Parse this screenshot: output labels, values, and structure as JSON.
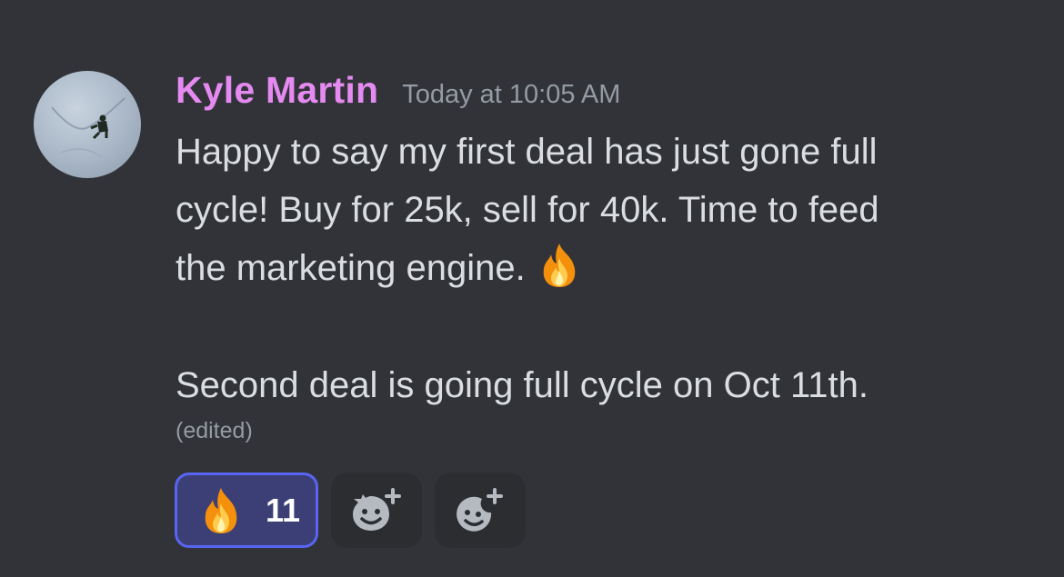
{
  "message": {
    "author": "Kyle Martin",
    "timestamp": "Today at 10:05 AM",
    "lines": [
      "Happy to say my first deal has just gone full",
      "cycle! Buy for 25k, sell for 40k. Time to feed",
      "the marketing engine.",
      "Second deal is going full cycle on Oct 11th."
    ],
    "edited_label": "(edited)",
    "inline_emoji": "fire-icon"
  },
  "reactions": [
    {
      "emoji": "fire-icon",
      "count": "11",
      "active": true
    }
  ],
  "buttons": {
    "add_super_reaction": "add-super-reaction-icon",
    "add_reaction": "add-reaction-icon"
  },
  "colors": {
    "background": "#313338",
    "username": "#e48af0",
    "timestamp": "#949ba4",
    "text": "#dbdee1",
    "reaction_border": "#5865f2",
    "reaction_bg": "#3b3f76",
    "button_bg": "#2b2d31"
  }
}
